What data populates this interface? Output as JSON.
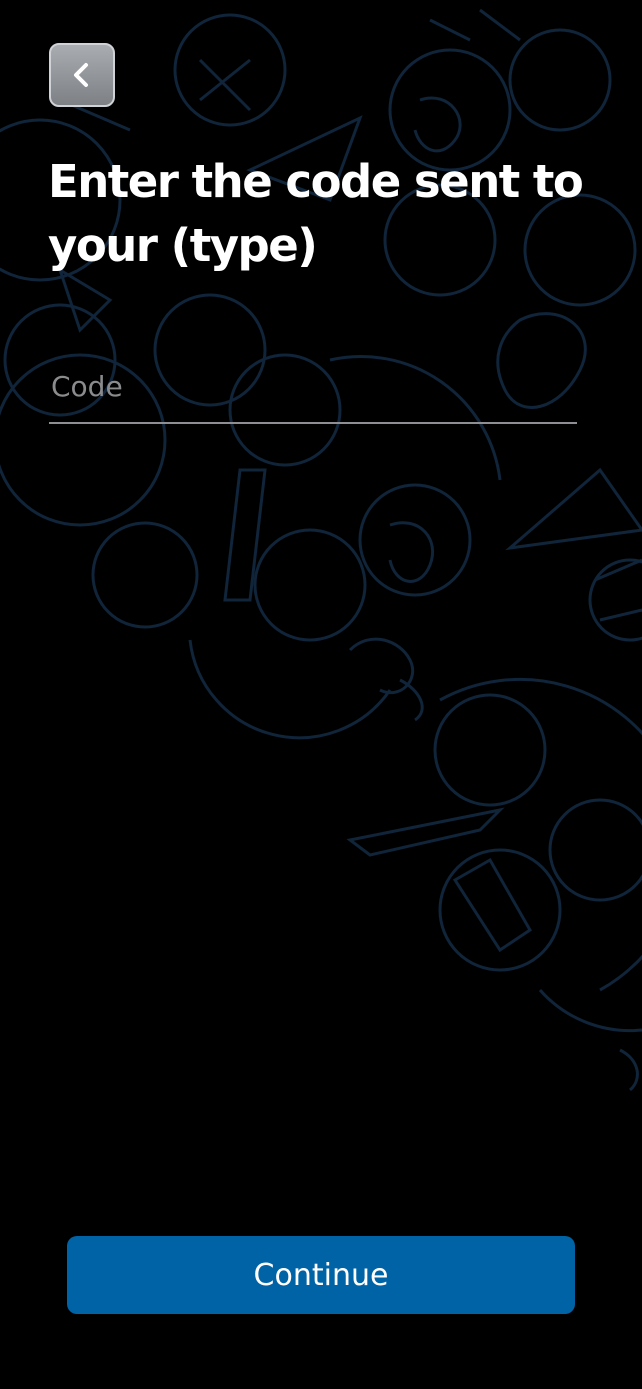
{
  "header": {
    "back_icon": "chevron-left-icon",
    "title": "Enter the code sent to your (type)"
  },
  "form": {
    "code_placeholder": "Code",
    "code_value": ""
  },
  "footer": {
    "continue_label": "Continue"
  },
  "colors": {
    "background": "#000000",
    "pattern_stroke": "#10243a",
    "primary_button": "#0063a6",
    "text": "#ffffff",
    "placeholder": "#8a8b8d"
  }
}
